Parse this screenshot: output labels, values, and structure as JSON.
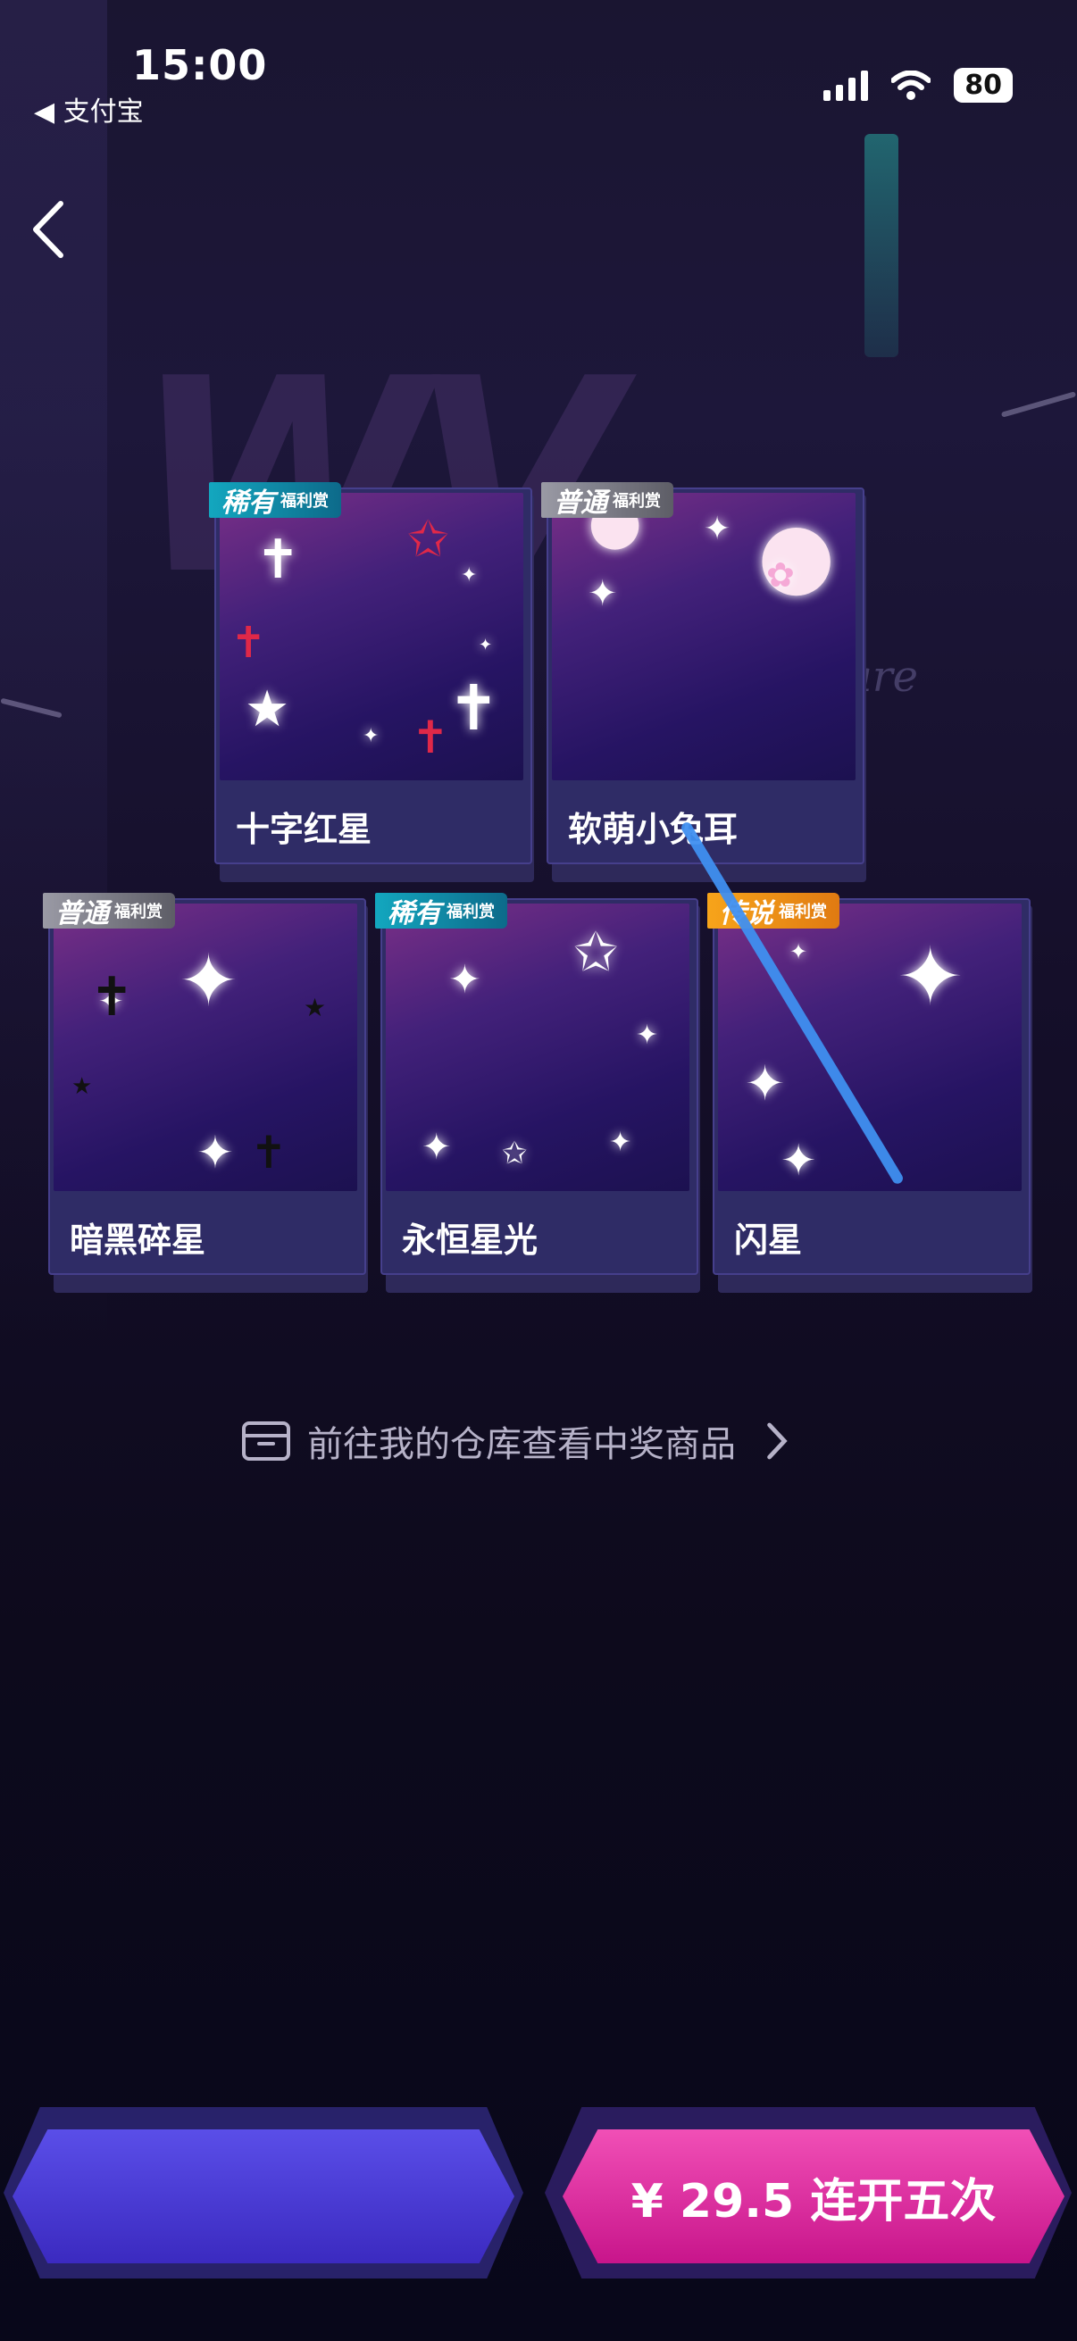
{
  "status_bar": {
    "time": "15:00",
    "back_app": "◀ 支付宝",
    "battery": "80"
  },
  "background": {
    "welfare_text": "lfare"
  },
  "cards": [
    {
      "badge": "稀有",
      "badge_sub": "福利赏",
      "badge_color": "#13a7bf",
      "name": "十字红星"
    },
    {
      "badge": "普通",
      "badge_sub": "福利赏",
      "badge_color": "#8d8d98",
      "name": "软萌小兔耳"
    },
    {
      "badge": "普通",
      "badge_sub": "福利赏",
      "badge_color": "#8d8d98",
      "name": "暗黑碎星"
    },
    {
      "badge": "稀有",
      "badge_sub": "福利赏",
      "badge_color": "#13a7bf",
      "name": "永恒星光"
    },
    {
      "badge": "传说",
      "badge_sub": "福利赏",
      "badge_color": "#f7a41a",
      "name": "闪星"
    }
  ],
  "warehouse_link": {
    "label": "前往我的仓库查看中奖商品",
    "icon": "box-icon"
  },
  "buttons": {
    "left_label": "",
    "right_label": "¥ 29.5 连开五次"
  },
  "colors": {
    "accent_pink": "#e3279f",
    "accent_purple": "#4a3bd6"
  }
}
